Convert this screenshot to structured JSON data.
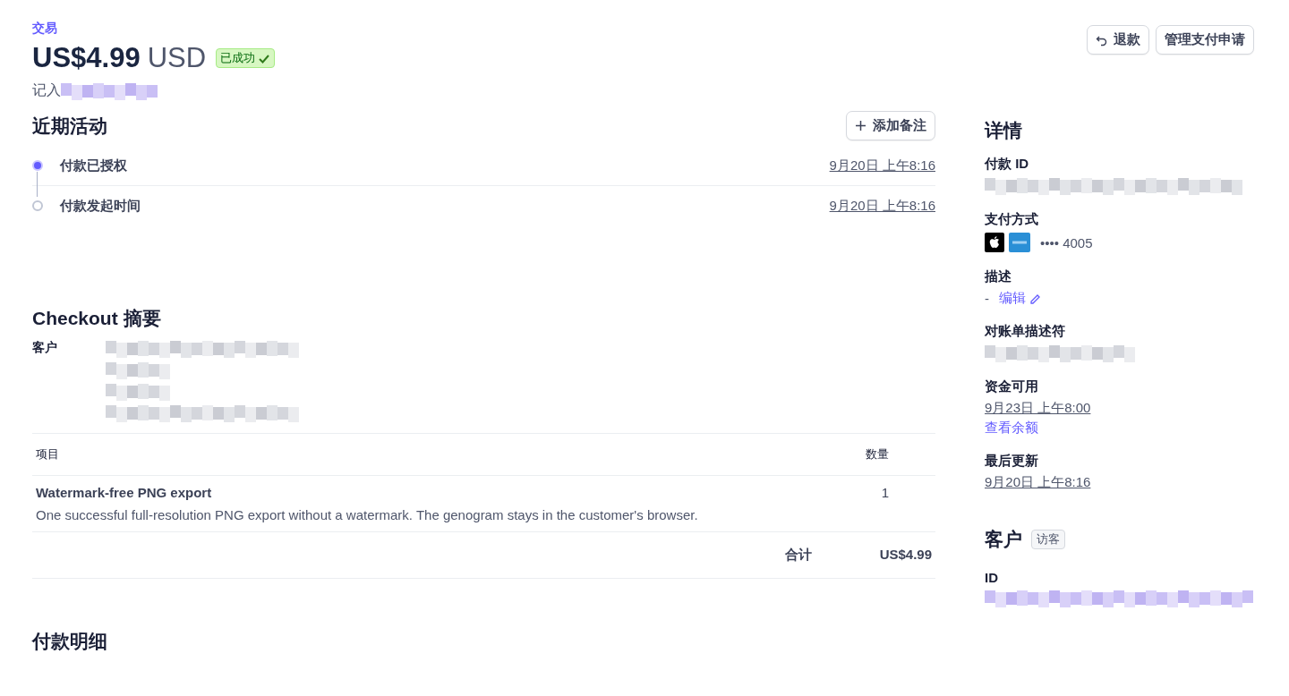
{
  "breadcrumb": "交易",
  "amount": "US$4.99",
  "currency": "USD",
  "status": {
    "label": "已成功",
    "kind": "success"
  },
  "statement": {
    "label": "记入",
    "value": {
      "kind": "redacted"
    }
  },
  "actions": [
    {
      "label": "退款",
      "kind": "undo"
    },
    {
      "label": "管理支付申请",
      "kind": "plain"
    }
  ],
  "activity": {
    "title": "近期活动",
    "add_note": "添加备注",
    "events": [
      {
        "label": "付款已授权",
        "time": "9月20日 上午8:16",
        "active": true
      },
      {
        "label": "付款发起时间",
        "time": "9月20日 上午8:16",
        "active": false
      }
    ]
  },
  "checkout": {
    "title": "Checkout 摘要",
    "customer_label": "客户",
    "customer_lines": [
      {
        "kind": "redacted"
      },
      {
        "kind": "redacted"
      },
      {
        "kind": "redacted"
      },
      {
        "kind": "redacted"
      }
    ],
    "table": {
      "columns": [
        "项目",
        "数量"
      ],
      "rows": [
        {
          "name": "Watermark-free PNG export",
          "description": "One successful full-resolution PNG export without a watermark. The genogram stays in the customer's browser.",
          "quantity": "1"
        }
      ]
    },
    "total_label": "合计",
    "total": "US$4.99"
  },
  "payment_breakdown": {
    "title": "付款明细"
  },
  "details": {
    "title": "详情",
    "fields": [
      {
        "label": "付款 ID",
        "kind": "redacted"
      },
      {
        "label": "支付方式",
        "kind": "card",
        "card": "•••• 4005"
      },
      {
        "label": "描述",
        "kind": "edit",
        "value": "-",
        "link": "编辑"
      },
      {
        "label": "对账单描述符",
        "kind": "redacted"
      },
      {
        "label": "资金可用",
        "kind": "date",
        "value": "9月23日 上午8:00",
        "link": "查看余额"
      },
      {
        "label": "最后更新",
        "kind": "date",
        "value": "9月20日 上午8:16"
      }
    ]
  },
  "customer": {
    "title": "客户",
    "badge": "访客",
    "fields": [
      {
        "label": "ID",
        "kind": "redacted_link"
      }
    ]
  }
}
